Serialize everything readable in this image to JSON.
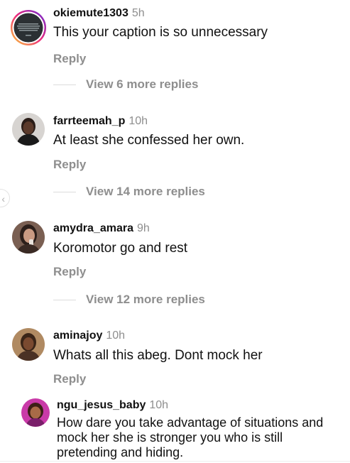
{
  "comments": [
    {
      "username": "okiemute1303",
      "time": "5h",
      "text": "This your caption is so unnecessary",
      "reply_label": "Reply",
      "view_more": "View 6 more replies"
    },
    {
      "username": "farrteemah_p",
      "time": "10h",
      "text": "At least she confessed her own.",
      "reply_label": "Reply",
      "view_more": "View 14 more replies"
    },
    {
      "username": "amydra_amara",
      "time": "9h",
      "text": "Koromotor go and rest",
      "reply_label": "Reply",
      "view_more": "View 12 more replies"
    },
    {
      "username": "aminajoy",
      "time": "10h",
      "text": "Whats all this abeg. Dont mock her",
      "reply_label": "Reply"
    },
    {
      "username": "ngu_jesus_baby",
      "time": "10h",
      "text": "How dare you take advantage of situations and mock her she is stronger you who is still pretending and hiding."
    }
  ],
  "icons": {
    "side_arrow": "chevron-left-icon",
    "story_ring": "story-ring"
  },
  "colors": {
    "secondary_text": "#8e8e8e",
    "divider": "#dbdbdb",
    "story_ring_start": "#f9ce34",
    "story_ring_mid": "#ee2a7b",
    "story_ring_end": "#6228d7"
  }
}
